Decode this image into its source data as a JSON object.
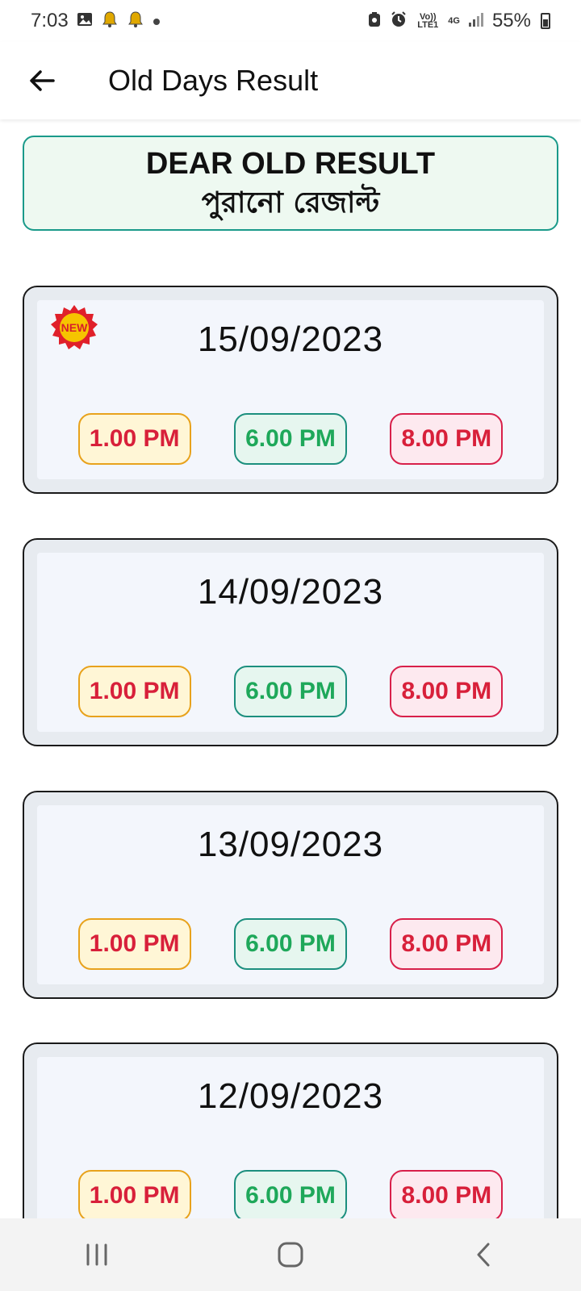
{
  "status_bar": {
    "time": "7:03",
    "battery": "55%",
    "network": "4G",
    "volte": "Vo)) LTE1"
  },
  "app_bar": {
    "title": "Old Days Result"
  },
  "header": {
    "title": "DEAR OLD RESULT",
    "subtitle": "পুরানো রেজাল্ট"
  },
  "new_badge": "NEW",
  "results": [
    {
      "date": "15/09/2023",
      "times": [
        "1.00 PM",
        "6.00 PM",
        "8.00 PM"
      ]
    },
    {
      "date": "14/09/2023",
      "times": [
        "1.00 PM",
        "6.00 PM",
        "8.00 PM"
      ]
    },
    {
      "date": "13/09/2023",
      "times": [
        "1.00 PM",
        "6.00 PM",
        "8.00 PM"
      ]
    },
    {
      "date": "12/09/2023",
      "times": [
        "1.00 PM",
        "6.00 PM",
        "8.00 PM"
      ]
    }
  ],
  "icons": {
    "back": "arrow-left-icon",
    "nav_recents": "recents-icon",
    "nav_home": "home-icon",
    "nav_back": "chevron-left-icon"
  }
}
